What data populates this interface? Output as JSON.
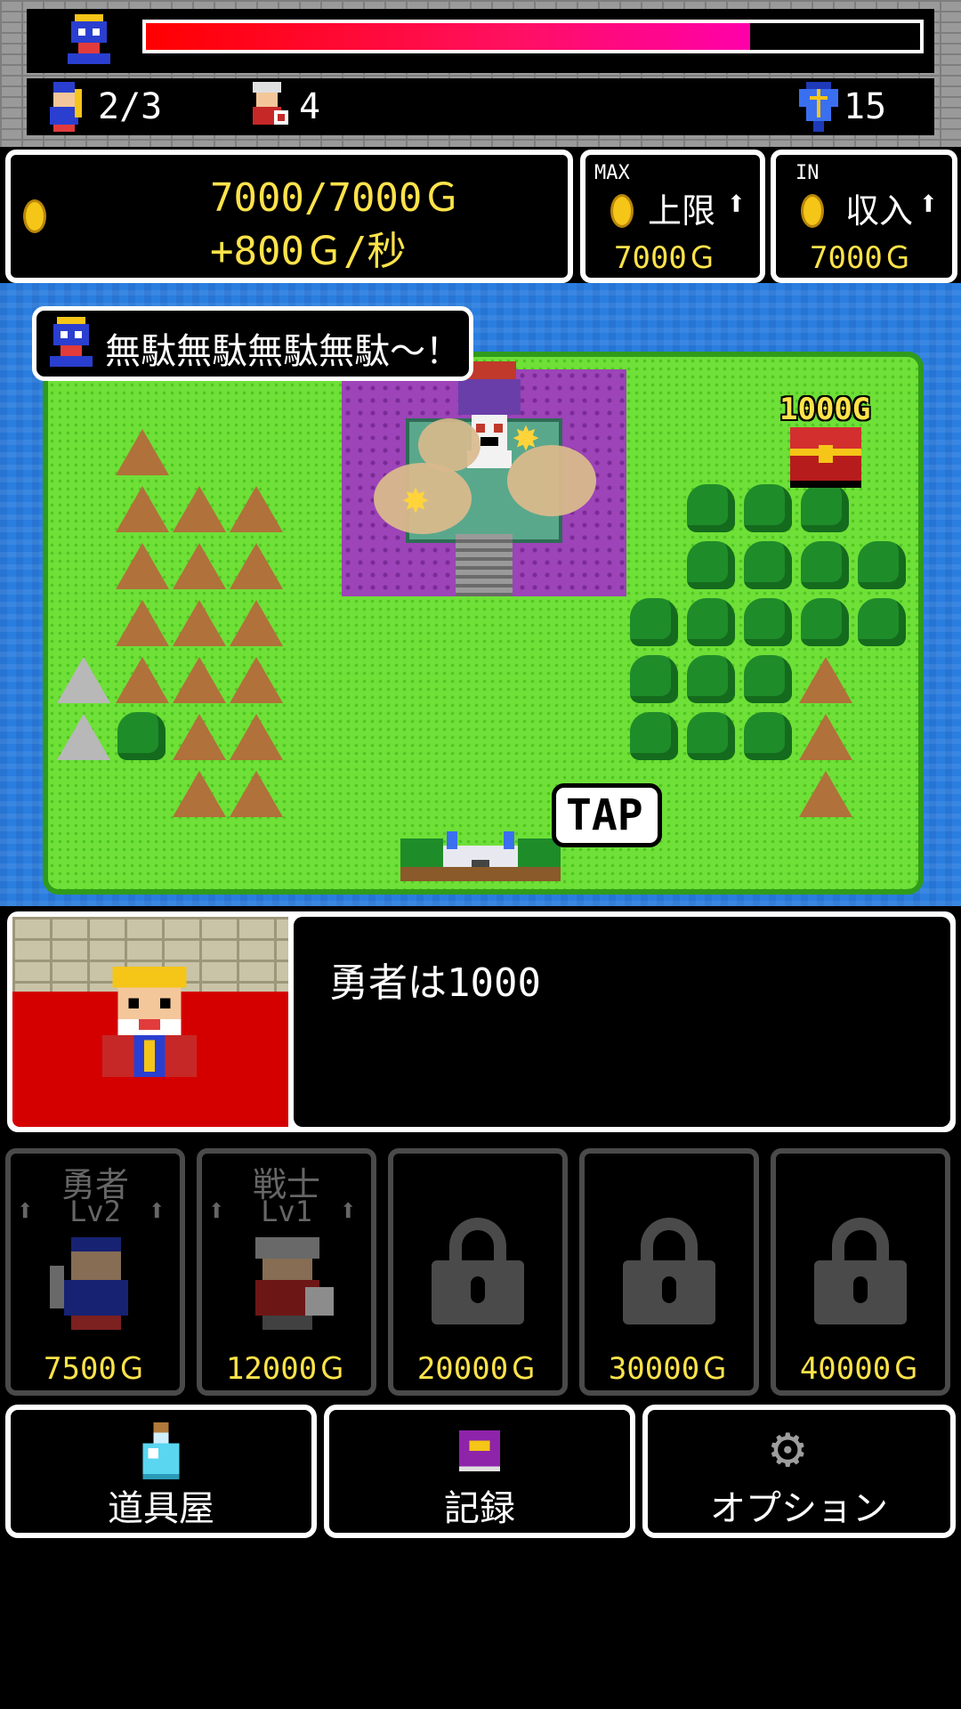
{
  "status": {
    "boss_hp_percent": 78,
    "heroes_count": "2/3",
    "warriors_count": "4",
    "crystal_count": "15"
  },
  "gold": {
    "amount": "7000/7000Ｇ",
    "rate": "+800Ｇ/秒"
  },
  "upgrades": {
    "max": {
      "tag": "MAX",
      "label": "上限",
      "price": "7000Ｇ"
    },
    "income": {
      "tag": "IN",
      "label": "収入",
      "price": "7000Ｇ"
    }
  },
  "map": {
    "boss_speech": "無駄無駄無駄無駄〜！",
    "treasure_label": "1000G",
    "tap_label": "TAP"
  },
  "dialogue": {
    "text": "勇者は1000"
  },
  "shop": [
    {
      "name": "勇者",
      "level": "Lv2",
      "price": "7500Ｇ",
      "locked": false
    },
    {
      "name": "戦士",
      "level": "Lv1",
      "price": "12000Ｇ",
      "locked": false
    },
    {
      "name": "",
      "level": "",
      "price": "20000Ｇ",
      "locked": true
    },
    {
      "name": "",
      "level": "",
      "price": "30000Ｇ",
      "locked": true
    },
    {
      "name": "",
      "level": "",
      "price": "40000Ｇ",
      "locked": true
    }
  ],
  "menu": {
    "item_shop": "道具屋",
    "records": "記録",
    "options": "オプション"
  },
  "colors": {
    "hp_bar": "#ff0050",
    "gold_text": "#ffe34a",
    "sea": "#2a7ee0",
    "grass": "#6ee037"
  }
}
